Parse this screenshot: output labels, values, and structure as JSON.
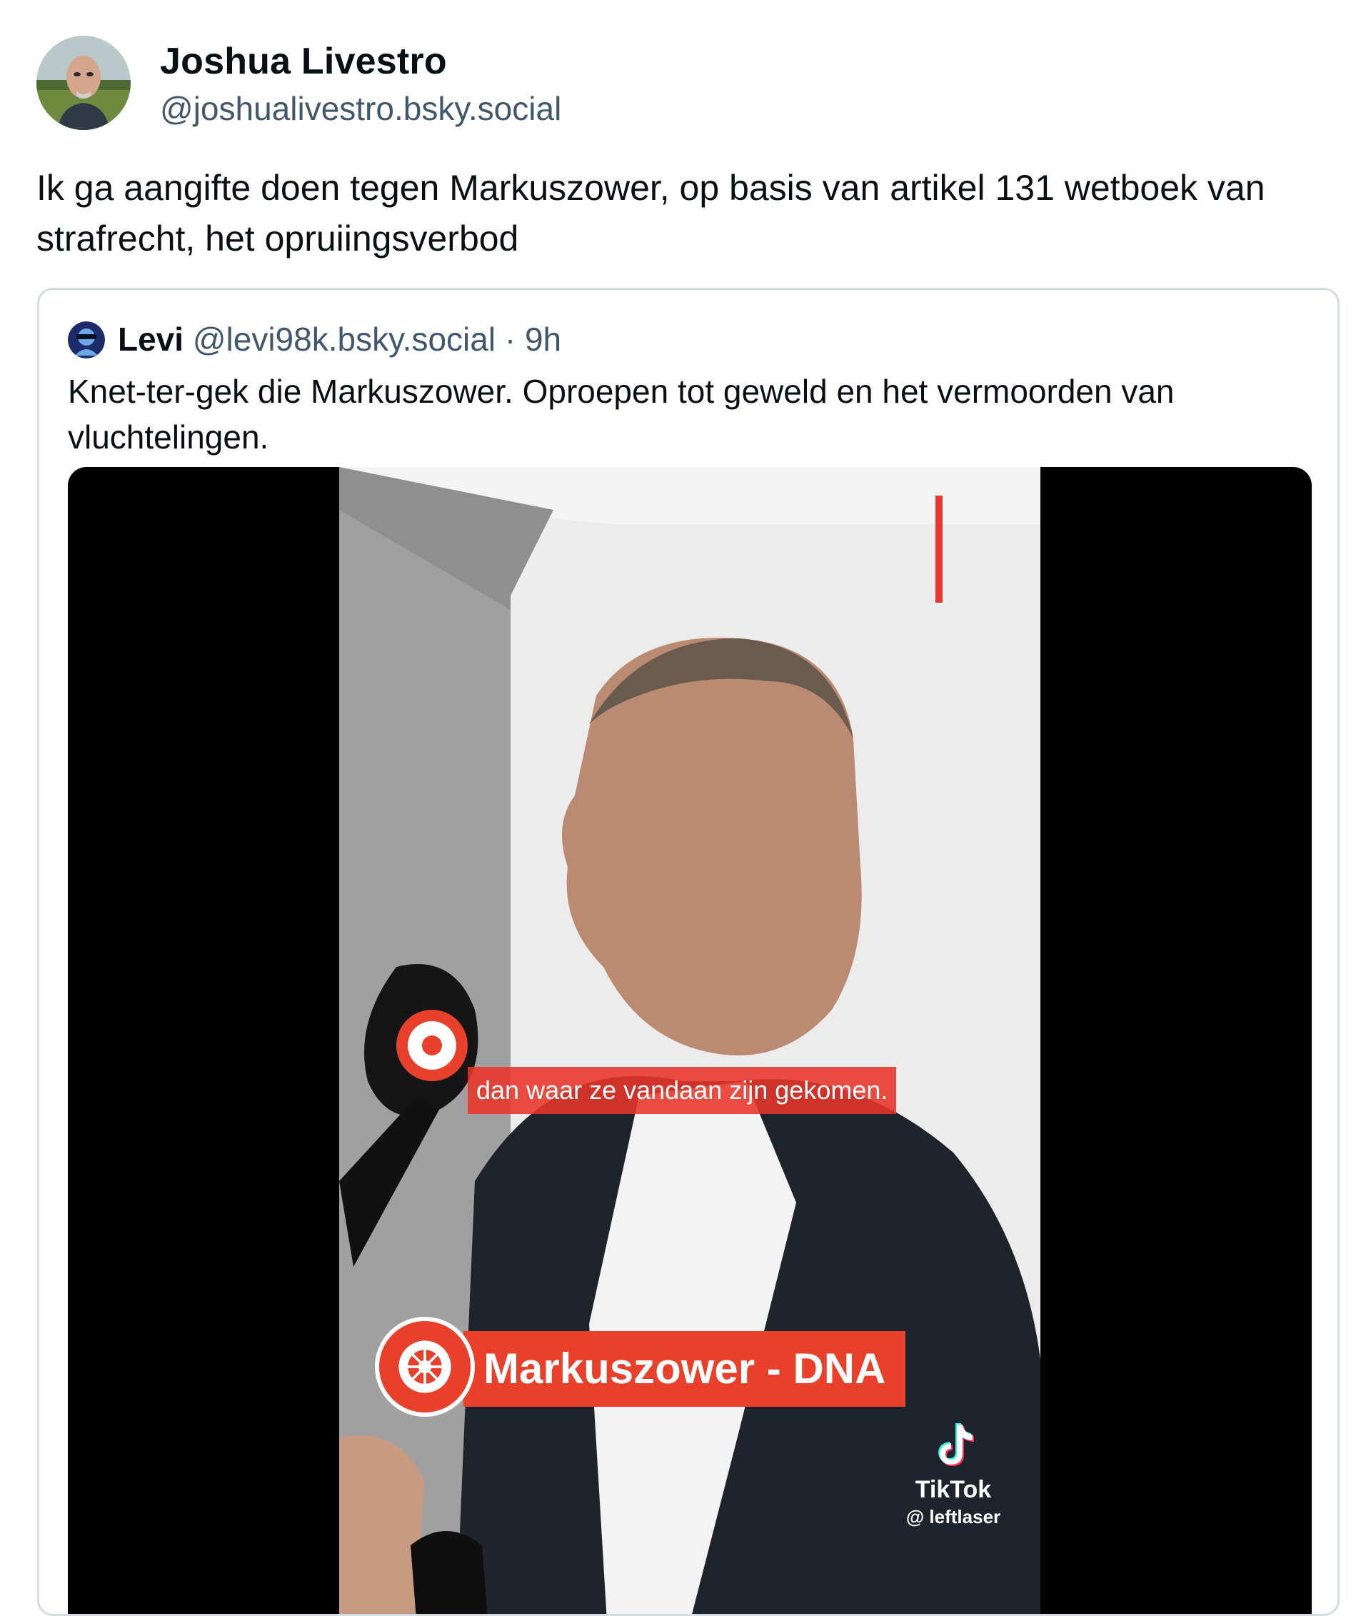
{
  "post": {
    "author": {
      "display_name": "Joshua Livestro",
      "handle": "@joshualivestro.bsky.social",
      "avatar_icon": "user-avatar-photo"
    },
    "text": "Ik ga aangifte doen tegen Markuszower, op basis van artikel 131 wetboek van strafrecht, het opruiingsverbod"
  },
  "quote": {
    "author": {
      "display_name": "Levi",
      "handle": "@levi98k.bsky.social",
      "separator": " · ",
      "time": "9h",
      "avatar_icon": "user-avatar-icon"
    },
    "text": "Knet-ter-gek die Markuszower. Oproepen tot geweld en het vermoorden van vluchtelingen.",
    "video": {
      "subtitle": "dan waar ze vandaan zijn gekomen.",
      "lower_third": "Markuszower - DNA",
      "watermark_name": "TikTok",
      "watermark_handle": "@ leftlaser",
      "accent_color": "#e8402a"
    }
  },
  "colors": {
    "text_primary": "#0b0f14",
    "text_secondary": "#42576c",
    "border": "#d4dbe2"
  }
}
